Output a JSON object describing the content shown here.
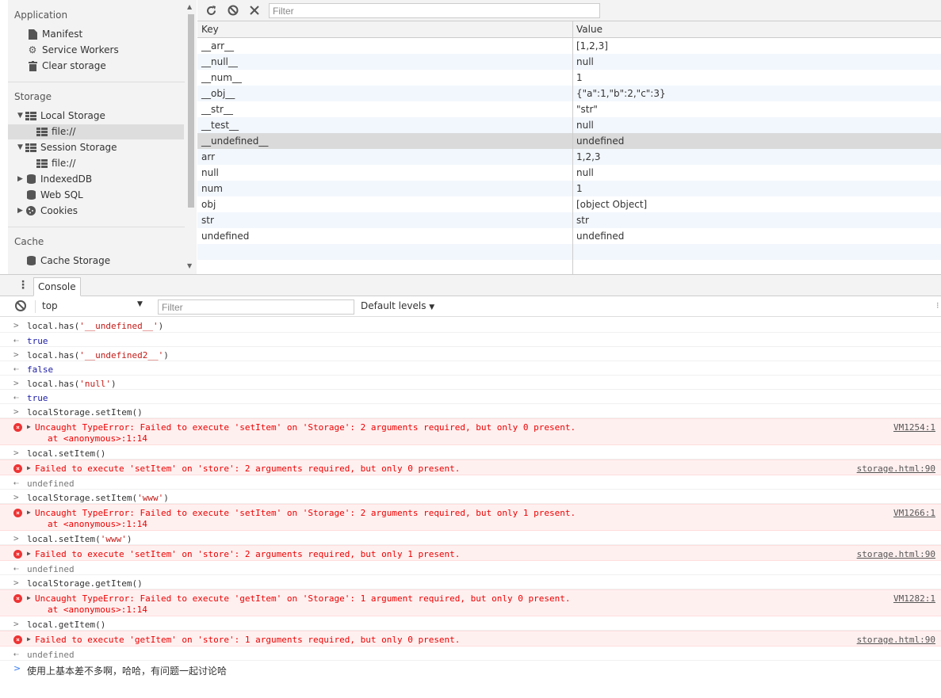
{
  "sidebar": {
    "application_title": "Application",
    "application_items": [
      {
        "label": "Manifest",
        "icon": "document-icon"
      },
      {
        "label": "Service Workers",
        "icon": "gear-icon"
      },
      {
        "label": "Clear storage",
        "icon": "trash-icon"
      }
    ],
    "storage_title": "Storage",
    "local_storage": {
      "label": "Local Storage",
      "child": "file://"
    },
    "session_storage": {
      "label": "Session Storage",
      "child": "file://"
    },
    "indexeddb": "IndexedDB",
    "websql": "Web SQL",
    "cookies": "Cookies",
    "cache_title": "Cache",
    "cache_storage": "Cache Storage"
  },
  "toolbar": {
    "refresh_icon": "refresh-icon",
    "clear_icon": "block-icon",
    "delete_icon": "close-icon",
    "filter_placeholder": "Filter"
  },
  "table": {
    "key_header": "Key",
    "value_header": "Value",
    "rows": [
      {
        "key": "__arr__",
        "value": "[1,2,3]"
      },
      {
        "key": "__null__",
        "value": "null"
      },
      {
        "key": "__num__",
        "value": "1"
      },
      {
        "key": "__obj__",
        "value": "{\"a\":1,\"b\":2,\"c\":3}"
      },
      {
        "key": "__str__",
        "value": "\"str\""
      },
      {
        "key": "__test__",
        "value": "null"
      },
      {
        "key": "__undefined__",
        "value": "undefined"
      },
      {
        "key": "arr",
        "value": "1,2,3"
      },
      {
        "key": "null",
        "value": "null"
      },
      {
        "key": "num",
        "value": "1"
      },
      {
        "key": "obj",
        "value": "[object Object]"
      },
      {
        "key": "str",
        "value": "str"
      },
      {
        "key": "undefined",
        "value": "undefined"
      }
    ]
  },
  "console": {
    "tab_label": "Console",
    "context": "top",
    "filter_placeholder": "Filter",
    "levels": "Default levels",
    "lines": [
      {
        "type": "in",
        "code": "local.has(",
        "str": "'__undefined__'",
        "end": ")"
      },
      {
        "type": "out",
        "bool": "true"
      },
      {
        "type": "in",
        "code": "local.has(",
        "str": "'__undefined2__'",
        "end": ")"
      },
      {
        "type": "out",
        "bool": "false"
      },
      {
        "type": "in",
        "code": "local.has(",
        "str": "'null'",
        "end": ")"
      },
      {
        "type": "out",
        "bool": "true"
      },
      {
        "type": "in",
        "code": "localStorage.setItem()"
      },
      {
        "type": "err",
        "msg": "Uncaught TypeError: Failed to execute 'setItem' on 'Storage': 2 arguments required, but only 0 present.",
        "trace": "at <anonymous>:1:14",
        "src": "VM1254:1"
      },
      {
        "type": "in",
        "code": "local.setItem()"
      },
      {
        "type": "err",
        "msg": "Failed to execute 'setItem' on 'store': 2 arguments required, but only 0 present.",
        "src": "storage.html:90"
      },
      {
        "type": "out",
        "undef": "undefined"
      },
      {
        "type": "in",
        "code": "localStorage.setItem(",
        "str": "'www'",
        "end": ")"
      },
      {
        "type": "err",
        "msg": "Uncaught TypeError: Failed to execute 'setItem' on 'Storage': 2 arguments required, but only 1 present.",
        "trace": "at <anonymous>:1:14",
        "src": "VM1266:1"
      },
      {
        "type": "in",
        "code": "local.setItem(",
        "str": "'www'",
        "end": ")"
      },
      {
        "type": "err",
        "msg": "Failed to execute 'setItem' on 'store': 2 arguments required, but only 1 present.",
        "src": "storage.html:90"
      },
      {
        "type": "out",
        "undef": "undefined"
      },
      {
        "type": "in",
        "code": "localStorage.getItem()"
      },
      {
        "type": "err",
        "msg": "Uncaught TypeError: Failed to execute 'getItem' on 'Storage': 1 argument required, but only 0 present.",
        "trace": "at <anonymous>:1:14",
        "src": "VM1282:1"
      },
      {
        "type": "in",
        "code": "local.getItem()"
      },
      {
        "type": "err",
        "msg": "Failed to execute 'getItem' on 'store': 1 arguments required, but only 0 present.",
        "src": "storage.html:90"
      },
      {
        "type": "out",
        "undef": "undefined"
      }
    ],
    "prompt_text": "使用上基本差不多啊，哈哈，有问题一起讨论哈"
  },
  "colors": {
    "error_bg": "#fff0f0",
    "error_text": "#ee0000",
    "string": "#c41a16",
    "keyword": "#1a1aa6",
    "selected_row": "#dadada",
    "alt_row": "#f2f7fd"
  }
}
